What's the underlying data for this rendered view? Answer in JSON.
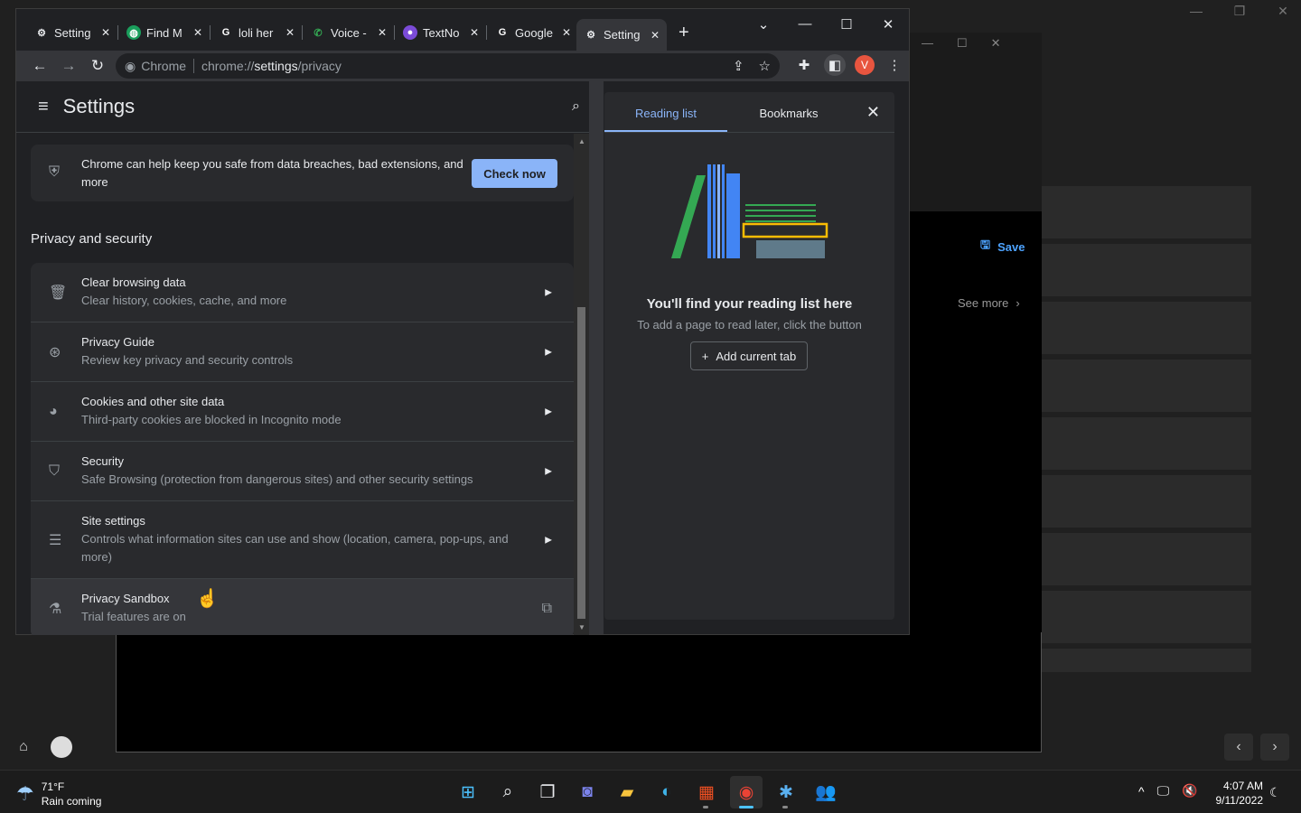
{
  "chrome": {
    "tabs": [
      {
        "label": "Setting",
        "icon": "gear-icon",
        "glyph": "⚙",
        "color": "#e8eaed",
        "bg": "transparent"
      },
      {
        "label": "Find M",
        "icon": "find-my-icon",
        "glyph": "◍",
        "color": "#ffffff",
        "bg": "#1a9e5c"
      },
      {
        "label": "loli her",
        "icon": "google-icon",
        "glyph": "G",
        "color": "#ffffff",
        "bg": "transparent"
      },
      {
        "label": "Voice -",
        "icon": "voice-icon",
        "glyph": "✆",
        "color": "#34a853",
        "bg": "transparent"
      },
      {
        "label": "TextNo",
        "icon": "textnow-icon",
        "glyph": "●",
        "color": "#ffffff",
        "bg": "#7b4bd8"
      },
      {
        "label": "Google",
        "icon": "google-icon",
        "glyph": "G",
        "color": "#ffffff",
        "bg": "transparent"
      },
      {
        "label": "Setting",
        "icon": "gear-icon",
        "glyph": "⚙",
        "color": "#e8eaed",
        "bg": "transparent"
      }
    ],
    "omnibox": {
      "site_label": "Chrome",
      "url_prefix": "chrome://",
      "url_bold": "settings",
      "url_suffix": "/privacy"
    },
    "profile_initial": "V"
  },
  "settings": {
    "title": "Settings",
    "check_card": {
      "text": "Chrome can help keep you safe from data breaches, bad extensions, and more",
      "button": "Check now"
    },
    "section_title": "Privacy and security",
    "items": [
      {
        "title": "Clear browsing data",
        "subtitle": "Clear history, cookies, cache, and more",
        "icon": "trash-icon",
        "glyph": "🗑"
      },
      {
        "title": "Privacy Guide",
        "subtitle": "Review key privacy and security controls",
        "icon": "privacy-guide-icon",
        "glyph": "⊛"
      },
      {
        "title": "Cookies and other site data",
        "subtitle": "Third-party cookies are blocked in Incognito mode",
        "icon": "cookie-icon",
        "glyph": "◕"
      },
      {
        "title": "Security",
        "subtitle": "Safe Browsing (protection from dangerous sites) and other security settings",
        "icon": "shield-icon",
        "glyph": "⛉"
      },
      {
        "title": "Site settings",
        "subtitle": "Controls what information sites can use and show (location, camera, pop-ups, and more)",
        "icon": "sliders-icon",
        "glyph": "☰"
      },
      {
        "title": "Privacy Sandbox",
        "subtitle": "Trial features are on",
        "icon": "flask-icon",
        "glyph": "⚗"
      }
    ]
  },
  "side_panel": {
    "tab_reading": "Reading list",
    "tab_bookmarks": "Bookmarks",
    "heading": "You'll find your reading list here",
    "subtitle": "To add a page to read later, click the button",
    "add_button": "Add current tab"
  },
  "background_app": {
    "save_label": "Save",
    "see_more_label": "See more"
  },
  "taskbar": {
    "temperature": "71°F",
    "condition": "Rain coming",
    "time": "4:07 AM",
    "date": "9/11/2022"
  }
}
